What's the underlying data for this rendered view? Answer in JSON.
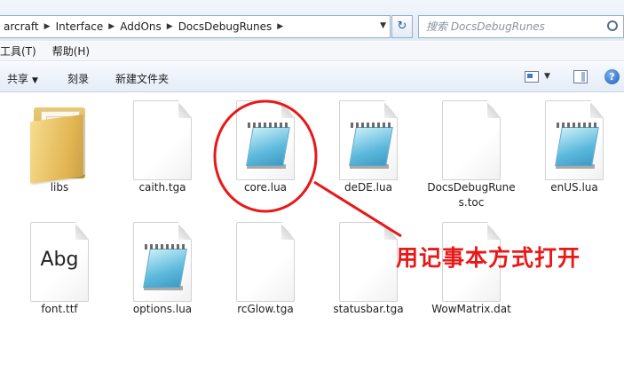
{
  "address_bar": {
    "breadcrumbs": [
      "arcraft",
      "Interface",
      "AddOns",
      "DocsDebugRunes"
    ],
    "search_placeholder": "搜索 DocsDebugRunes"
  },
  "menu": {
    "items": [
      "工具(T)",
      "帮助(H)"
    ]
  },
  "toolbar": {
    "share_label": "共享",
    "burn_label": "刻录",
    "new_folder_label": "新建文件夹",
    "help_label": "?"
  },
  "files": [
    {
      "name": "libs",
      "icon": "folder-icon"
    },
    {
      "name": "caith.tga",
      "icon": "blank-file-icon"
    },
    {
      "name": "core.lua",
      "icon": "notepad-icon"
    },
    {
      "name": "deDE.lua",
      "icon": "notepad-icon"
    },
    {
      "name": "DocsDebugRunes.toc",
      "icon": "blank-file-icon"
    },
    {
      "name": "enUS.lua",
      "icon": "notepad-icon"
    },
    {
      "name": "font.ttf",
      "icon": "font-file-icon"
    },
    {
      "name": "options.lua",
      "icon": "notepad-icon"
    },
    {
      "name": "rcGlow.tga",
      "icon": "blank-file-icon"
    },
    {
      "name": "statusbar.tga",
      "icon": "blank-file-icon"
    },
    {
      "name": "WowMatrix.dat",
      "icon": "blank-file-icon"
    }
  ],
  "font_preview_text": "Abg",
  "annotation": {
    "text": "用记事本方式打开",
    "color": "#e81818"
  }
}
